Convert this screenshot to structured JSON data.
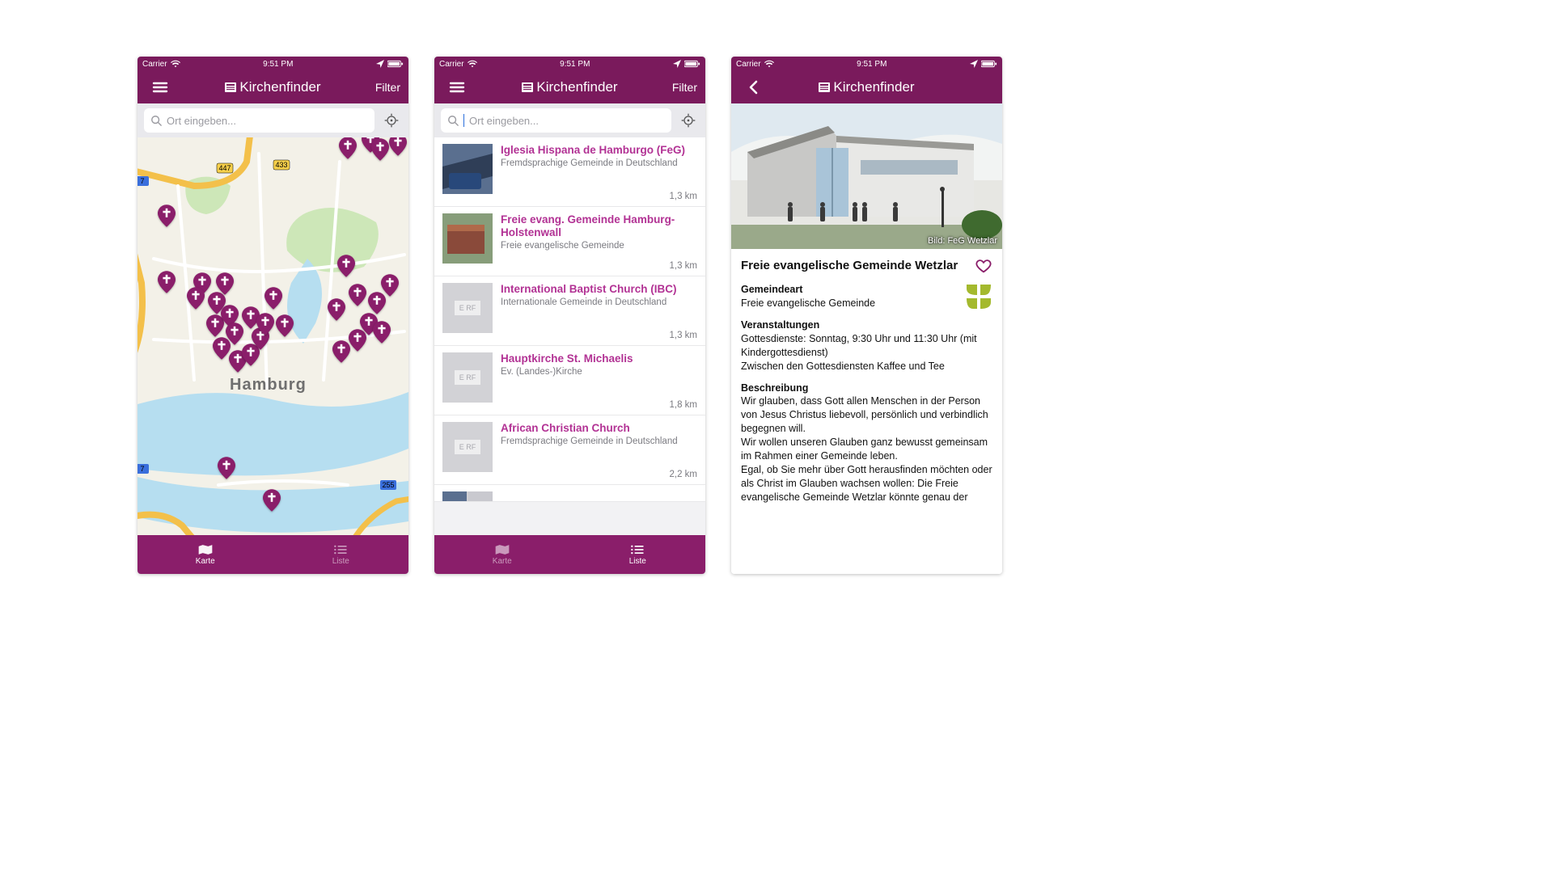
{
  "status": {
    "carrier": "Carrier",
    "time": "9:51 PM"
  },
  "app": {
    "title": "Kirchenfinder",
    "filter": "Filter"
  },
  "search": {
    "placeholder": "Ort eingeben...",
    "cursor_value": ""
  },
  "tabs": {
    "map": "Karte",
    "list": "Liste"
  },
  "map": {
    "city_label": "Hamburg"
  },
  "list_items": [
    {
      "title": "Iglesia Hispana de Hamburgo (FeG)",
      "subtitle": "Fremdsprachige Gemeinde in Deutschland",
      "distance": "1,3 km"
    },
    {
      "title": "Freie evang. Gemeinde Hamburg-Holstenwall",
      "subtitle": "Freie evangelische Gemeinde",
      "distance": "1,3 km"
    },
    {
      "title": "International Baptist Church (IBC)",
      "subtitle": "Internationale Gemeinde in Deutschland",
      "distance": "1,3 km"
    },
    {
      "title": "Hauptkirche St. Michaelis",
      "subtitle": "Ev. (Landes-)Kirche",
      "distance": "1,8 km"
    },
    {
      "title": "African Christian Church",
      "subtitle": "Fremdsprachige Gemeinde in Deutschland",
      "distance": "2,2 km"
    }
  ],
  "detail": {
    "hero_caption": "Bild: FeG Wetzlar",
    "title": "Freie evangelische Gemeinde Wetzlar",
    "section_type_label": "Gemeindeart",
    "section_type_value": "Freie evangelische Gemeinde",
    "section_events_label": "Veranstaltungen",
    "section_events_body": "Gottesdienste: Sonntag, 9:30 Uhr und 11:30 Uhr (mit Kindergottesdienst)\nZwischen den Gottesdiensten Kaffee und Tee",
    "section_desc_label": "Beschreibung",
    "section_desc_body": "Wir glauben, dass Gott allen Menschen in der Person von Jesus Christus liebevoll, persönlich und verbindlich begegnen will.\nWir wollen unseren Glauben ganz bewusst gemeinsam im Rahmen einer Gemeinde leben.\nEgal, ob Sie mehr über Gott herausfinden möchten oder als Christ im Glauben wachsen wollen: Die Freie evangelische Gemeinde Wetzlar könnte genau der"
  }
}
